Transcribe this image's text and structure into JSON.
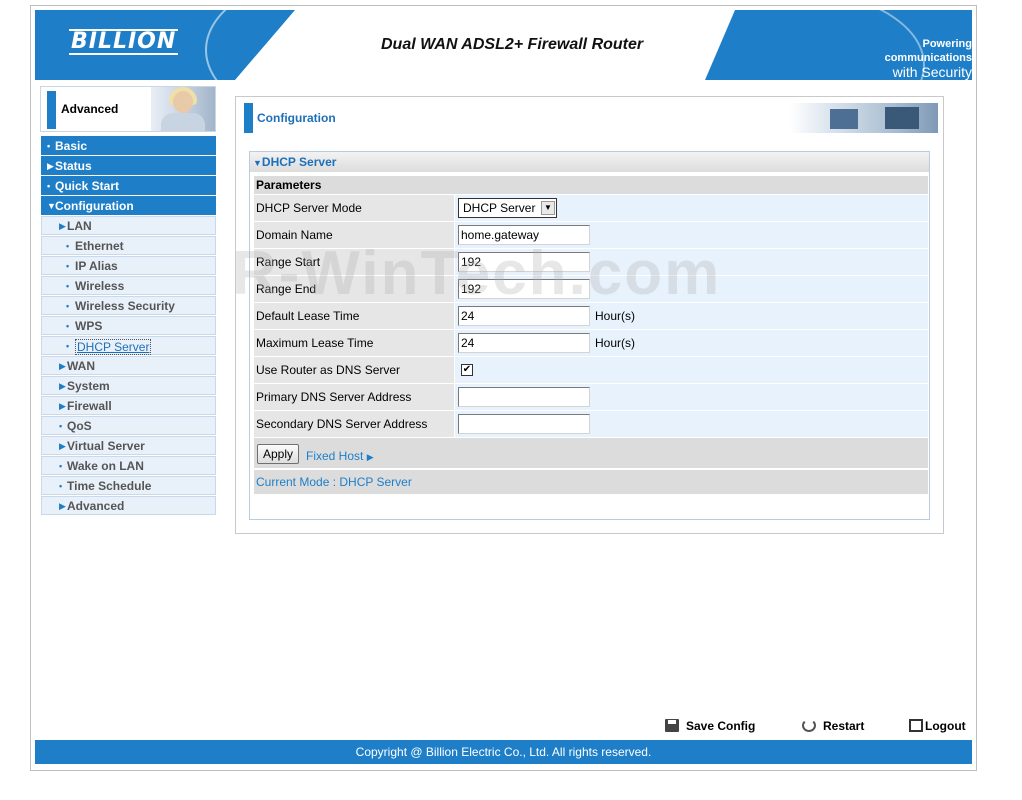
{
  "header": {
    "logo": "BILLION",
    "product_title": "Dual WAN ADSL2+ Firewall Router",
    "tagline_1": "Powering communications",
    "tagline_2": "with Security"
  },
  "sidebar": {
    "section_title": "Advanced",
    "items": [
      {
        "label": "Basic",
        "level": "top",
        "marker": "dot"
      },
      {
        "label": "Status",
        "level": "top",
        "marker": "arrow-right"
      },
      {
        "label": "Quick Start",
        "level": "top",
        "marker": "dot"
      },
      {
        "label": "Configuration",
        "level": "top",
        "marker": "arrow-down"
      },
      {
        "label": "LAN",
        "level": "sub",
        "marker": "arrow-right"
      },
      {
        "label": "Ethernet",
        "level": "sub2",
        "marker": "dot"
      },
      {
        "label": "IP Alias",
        "level": "sub2",
        "marker": "dot"
      },
      {
        "label": "Wireless",
        "level": "sub2",
        "marker": "dot"
      },
      {
        "label": "Wireless Security",
        "level": "sub2",
        "marker": "dot"
      },
      {
        "label": "WPS",
        "level": "sub2",
        "marker": "dot"
      },
      {
        "label": "DHCP Server",
        "level": "sub2",
        "marker": "dot",
        "current": true
      },
      {
        "label": "WAN",
        "level": "sub",
        "marker": "arrow-right"
      },
      {
        "label": "System",
        "level": "sub",
        "marker": "arrow-right"
      },
      {
        "label": "Firewall",
        "level": "sub",
        "marker": "arrow-right"
      },
      {
        "label": "QoS",
        "level": "sub",
        "marker": "dot"
      },
      {
        "label": "Virtual Server",
        "level": "sub",
        "marker": "arrow-right"
      },
      {
        "label": "Wake on LAN",
        "level": "sub",
        "marker": "dot"
      },
      {
        "label": "Time Schedule",
        "level": "sub",
        "marker": "dot"
      },
      {
        "label": "Advanced",
        "level": "sub",
        "marker": "arrow-right"
      }
    ]
  },
  "panel": {
    "title": "Configuration",
    "section_title": "DHCP Server",
    "params_title": "Parameters",
    "fields": {
      "mode_label": "DHCP Server Mode",
      "mode_value": "DHCP Server",
      "domain_label": "Domain Name",
      "domain_value": "home.gateway",
      "range_start_label": "Range Start",
      "range_start_value": "192",
      "range_end_label": "Range End",
      "range_end_value": "192",
      "default_lease_label": "Default Lease Time",
      "default_lease_value": "24",
      "max_lease_label": "Maximum Lease Time",
      "max_lease_value": "24",
      "hours_unit": "Hour(s)",
      "use_router_dns_label": "Use Router as DNS Server",
      "use_router_dns_checked": true,
      "primary_dns_label": "Primary DNS Server Address",
      "primary_dns_value": "",
      "secondary_dns_label": "Secondary DNS Server Address",
      "secondary_dns_value": ""
    },
    "apply_label": "Apply",
    "fixed_host_label": "Fixed Host",
    "current_mode": "Current Mode : DHCP Server"
  },
  "watermark": "R-WinTech.com",
  "footer": {
    "save_config": "Save Config",
    "restart": "Restart",
    "logout": "Logout",
    "copyright": "Copyright @ Billion Electric Co., Ltd. All rights reserved."
  },
  "colors": {
    "accent": "#1e7fc8",
    "link": "#1e6fb8",
    "row_label_bg": "#e6e6e6",
    "row_value_bg": "#e8f2fc"
  }
}
